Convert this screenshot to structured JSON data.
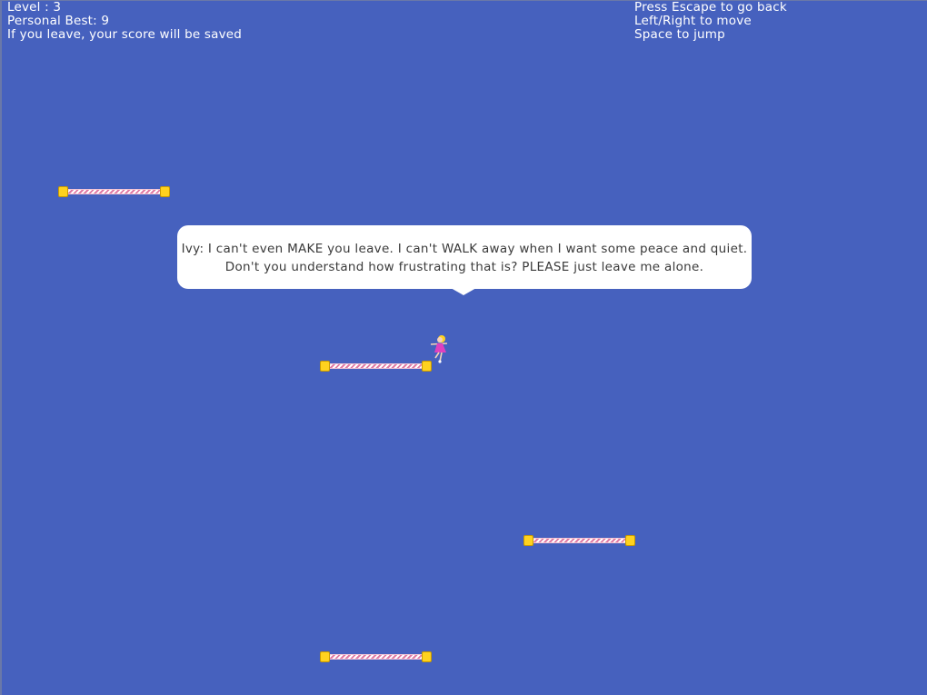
{
  "hud": {
    "level": "Level : 3",
    "personal_best": "Personal Best: 9",
    "leave_notice": "If you leave, your score will be saved",
    "escape_hint": "Press Escape to go back",
    "move_hint": "Left/Right to move",
    "jump_hint": "Space to jump"
  },
  "dialogue": {
    "line1": "Ivy: I can't even MAKE you leave. I can't WALK away when I want some peace and quiet.",
    "line2": "Don't you understand how frustrating that is? PLEASE just leave me alone."
  },
  "colors": {
    "background": "#4661be",
    "platform_post": "#ffd21f",
    "platform_rope": "#e07aa4",
    "player_dress": "#e040c0",
    "player_hair": "#ffd21f"
  },
  "icons": {
    "player": "dancer-character-icon",
    "platform_post": "yellow-post-icon"
  }
}
